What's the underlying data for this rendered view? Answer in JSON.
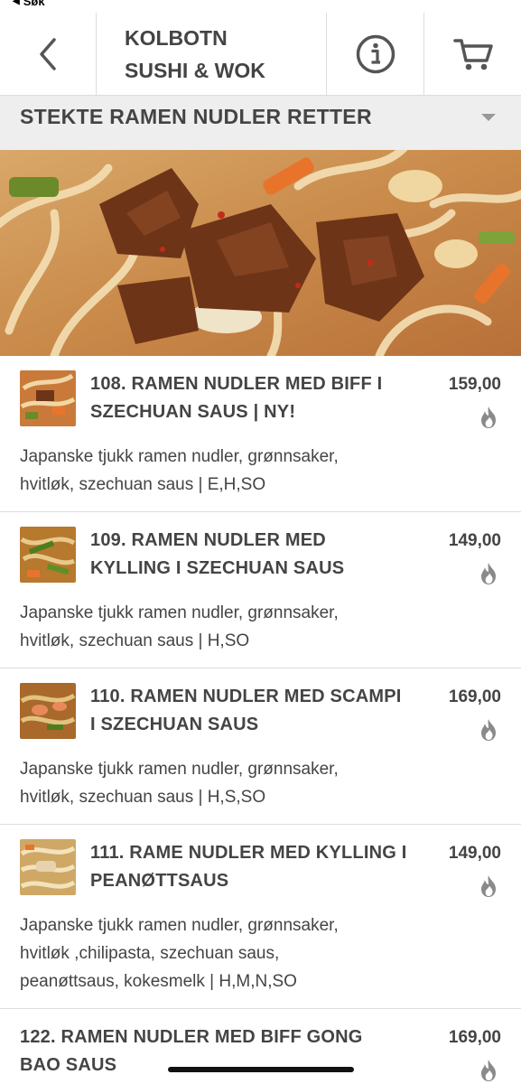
{
  "status": {
    "back_label": "Søk"
  },
  "header": {
    "title_line1": "KOLBOTN",
    "title_line2": "SUSHI & WOK"
  },
  "category": {
    "title": "STEKTE RAMEN NUDLER RETTER"
  },
  "items": [
    {
      "name_line1": "108. RAMEN NUDLER MED BIFF I",
      "name_line2": "SZECHUAN SAUS | NY!",
      "price": "159,00",
      "desc_line1": "Japanske tjukk ramen nudler, grønnsaker,",
      "desc_line2": "hvitløk, szechuan saus | E,H,SO",
      "desc_line3": "",
      "has_image": true,
      "spicy": true
    },
    {
      "name_line1": "109. RAMEN NUDLER MED",
      "name_line2": "KYLLING I SZECHUAN SAUS",
      "price": "149,00",
      "desc_line1": "Japanske tjukk ramen nudler, grønnsaker,",
      "desc_line2": "hvitløk, szechuan saus | H,SO",
      "desc_line3": "",
      "has_image": true,
      "spicy": true
    },
    {
      "name_line1": "110. RAMEN NUDLER MED SCAMPI",
      "name_line2": "I SZECHUAN SAUS",
      "price": "169,00",
      "desc_line1": "Japanske tjukk ramen nudler, grønnsaker,",
      "desc_line2": "hvitløk, szechuan saus | H,S,SO",
      "desc_line3": "",
      "has_image": true,
      "spicy": true
    },
    {
      "name_line1": "111. RAME NUDLER MED KYLLING I",
      "name_line2": "PEANØTTSAUS",
      "price": "149,00",
      "desc_line1": "Japanske tjukk ramen nudler, grønnsaker,",
      "desc_line2": "hvitløk ,chilipasta, szechuan saus,",
      "desc_line3": "peanøttsaus, kokesmelk | H,M,N,SO",
      "has_image": true,
      "spicy": true
    },
    {
      "name_line1": "122. RAMEN NUDLER MED BIFF GONG",
      "name_line2": "BAO SAUS",
      "price": "169,00",
      "desc_line1": "",
      "desc_line2": "",
      "desc_line3": "",
      "has_image": false,
      "spicy": true
    }
  ],
  "icons": {
    "back": "chevron-left-icon",
    "info": "info-icon",
    "cart": "cart-icon",
    "spicy": "flame-icon",
    "dropdown": "caret-down-icon"
  },
  "colors": {
    "text": "#444444",
    "category_bg": "#eeeeee",
    "divider": "#dddddd",
    "flame": "#8a8a8a"
  }
}
